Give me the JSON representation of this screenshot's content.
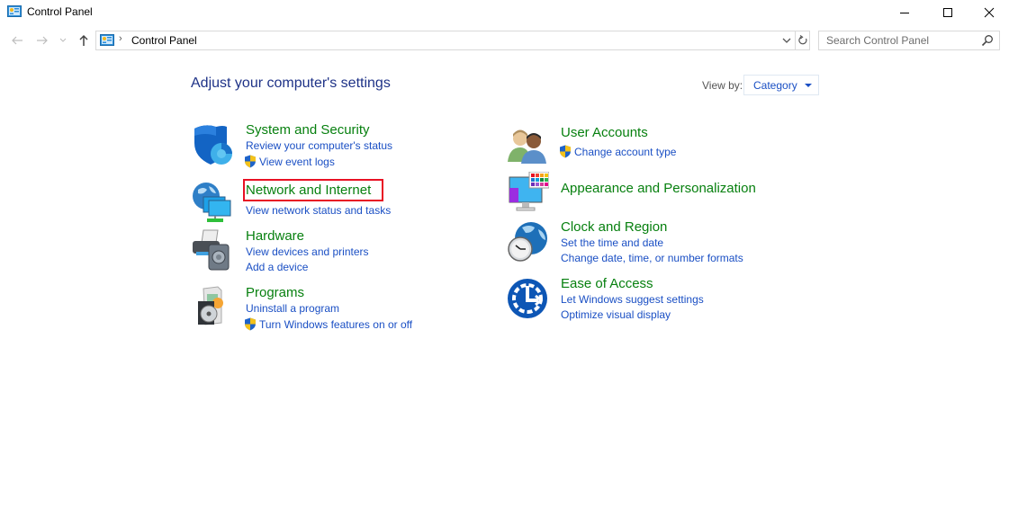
{
  "window": {
    "title": "Control Panel",
    "controls": {
      "minimize": "minimize",
      "maximize": "maximize",
      "close": "close"
    }
  },
  "address": {
    "breadcrumb": [
      "Control Panel"
    ],
    "search_placeholder": "Search Control Panel"
  },
  "main": {
    "heading": "Adjust your computer's settings",
    "view_by_label": "View by:",
    "view_by_value": "Category",
    "highlighted_item": "Network and Internet",
    "highlight_color": "#e81123",
    "title_color": "#07800f",
    "link_color": "#1a4fc4",
    "categories": [
      {
        "title": "System and Security",
        "icon": "shield-chart-icon",
        "links": [
          {
            "label": "Review your computer's status",
            "shield": false
          },
          {
            "label": "View event logs",
            "shield": true
          }
        ]
      },
      {
        "title": "Network and Internet",
        "icon": "network-globe-icon",
        "links": [
          {
            "label": "View network status and tasks",
            "shield": false
          }
        ]
      },
      {
        "title": "Hardware",
        "icon": "printer-speaker-icon",
        "links": [
          {
            "label": "View devices and printers",
            "shield": false
          },
          {
            "label": "Add a device",
            "shield": false
          }
        ]
      },
      {
        "title": "Programs",
        "icon": "program-disc-icon",
        "links": [
          {
            "label": "Uninstall a program",
            "shield": false
          },
          {
            "label": "Turn Windows features on or off",
            "shield": true
          }
        ]
      },
      {
        "title": "User Accounts",
        "icon": "users-icon",
        "links": [
          {
            "label": "Change account type",
            "shield": true
          }
        ]
      },
      {
        "title": "Appearance and Personalization",
        "icon": "monitor-palette-icon",
        "links": []
      },
      {
        "title": "Clock and Region",
        "icon": "globe-clock-icon",
        "links": [
          {
            "label": "Set the time and date",
            "shield": false
          },
          {
            "label": "Change date, time, or number formats",
            "shield": false
          }
        ]
      },
      {
        "title": "Ease of Access",
        "icon": "ease-of-access-icon",
        "links": [
          {
            "label": "Let Windows suggest settings",
            "shield": false
          },
          {
            "label": "Optimize visual display",
            "shield": false
          }
        ]
      }
    ]
  }
}
